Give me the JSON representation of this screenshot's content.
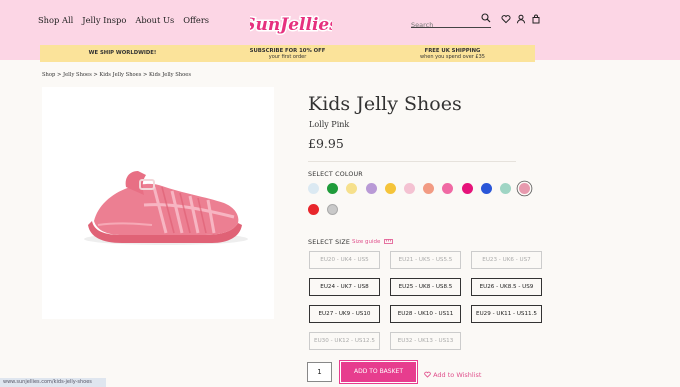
{
  "nav": [
    "Shop All",
    "Jelly Inspo",
    "About Us",
    "Offers"
  ],
  "logo": {
    "text": "SunJellies",
    "color": "#e6317f"
  },
  "search": {
    "placeholder": "Search"
  },
  "promo": [
    {
      "title": "WE SHIP WORLDWIDE!",
      "sub": ""
    },
    {
      "title": "SUBSCRIBE FOR 10% OFF",
      "sub": "your first order"
    },
    {
      "title": "FREE UK SHIPPING",
      "sub": "when you spend over £35"
    }
  ],
  "breadcrumb": "Shop > Jelly Shoes > Kids Jelly Shoes > Kids Jelly Shoes",
  "product": {
    "title": "Kids Jelly Shoes",
    "colour_name": "Lolly Pink",
    "price": "£9.95"
  },
  "colour_label": "SELECT COLOUR",
  "colours": [
    {
      "name": "pale-blue",
      "hex": "#dbe9f2"
    },
    {
      "name": "green",
      "hex": "#1f9b3a"
    },
    {
      "name": "lemon",
      "hex": "#f6e08c"
    },
    {
      "name": "lilac",
      "hex": "#b99ad6"
    },
    {
      "name": "yellow",
      "hex": "#f5c43a"
    },
    {
      "name": "baby-pink",
      "hex": "#f4c2d2"
    },
    {
      "name": "peach",
      "hex": "#f29b83"
    },
    {
      "name": "glitter-pink",
      "hex": "#f06aa4"
    },
    {
      "name": "hot-pink",
      "hex": "#e6137a"
    },
    {
      "name": "blue",
      "hex": "#2a56d8"
    },
    {
      "name": "mint",
      "hex": "#9fd5c4"
    },
    {
      "name": "lolly-pink",
      "hex": "#e79aae",
      "selected": true
    },
    {
      "name": "red",
      "hex": "#e8262b"
    },
    {
      "name": "silver",
      "hex": "#c9c9c9"
    }
  ],
  "size_label": "SELECT SIZE",
  "size_guide": "Size guide",
  "sizes": [
    {
      "label": "EU20 - UK4 - US5",
      "available": false
    },
    {
      "label": "EU21 - UK5 - US5.5",
      "available": false
    },
    {
      "label": "EU23 - UK6 - US7",
      "available": false
    },
    {
      "label": "EU24 - UK7 - US8",
      "available": true
    },
    {
      "label": "EU25 - UK8 - US8.5",
      "available": true
    },
    {
      "label": "EU26 - UK8.5 - US9",
      "available": true
    },
    {
      "label": "EU27 - UK9 - US10",
      "available": true
    },
    {
      "label": "EU28 - UK10 - US11",
      "available": true
    },
    {
      "label": "EU29 - UK11 - US11.5",
      "available": true
    },
    {
      "label": "EU30 - UK12 - US12.5",
      "available": false
    },
    {
      "label": "EU32 - UK13 - US13",
      "available": false
    }
  ],
  "quantity": "1",
  "add_to_basket": "ADD TO BASKET",
  "wishlist": "Add to Wishlist",
  "status_bar": "www.sunjellies.com/kids-jelly-shoes"
}
